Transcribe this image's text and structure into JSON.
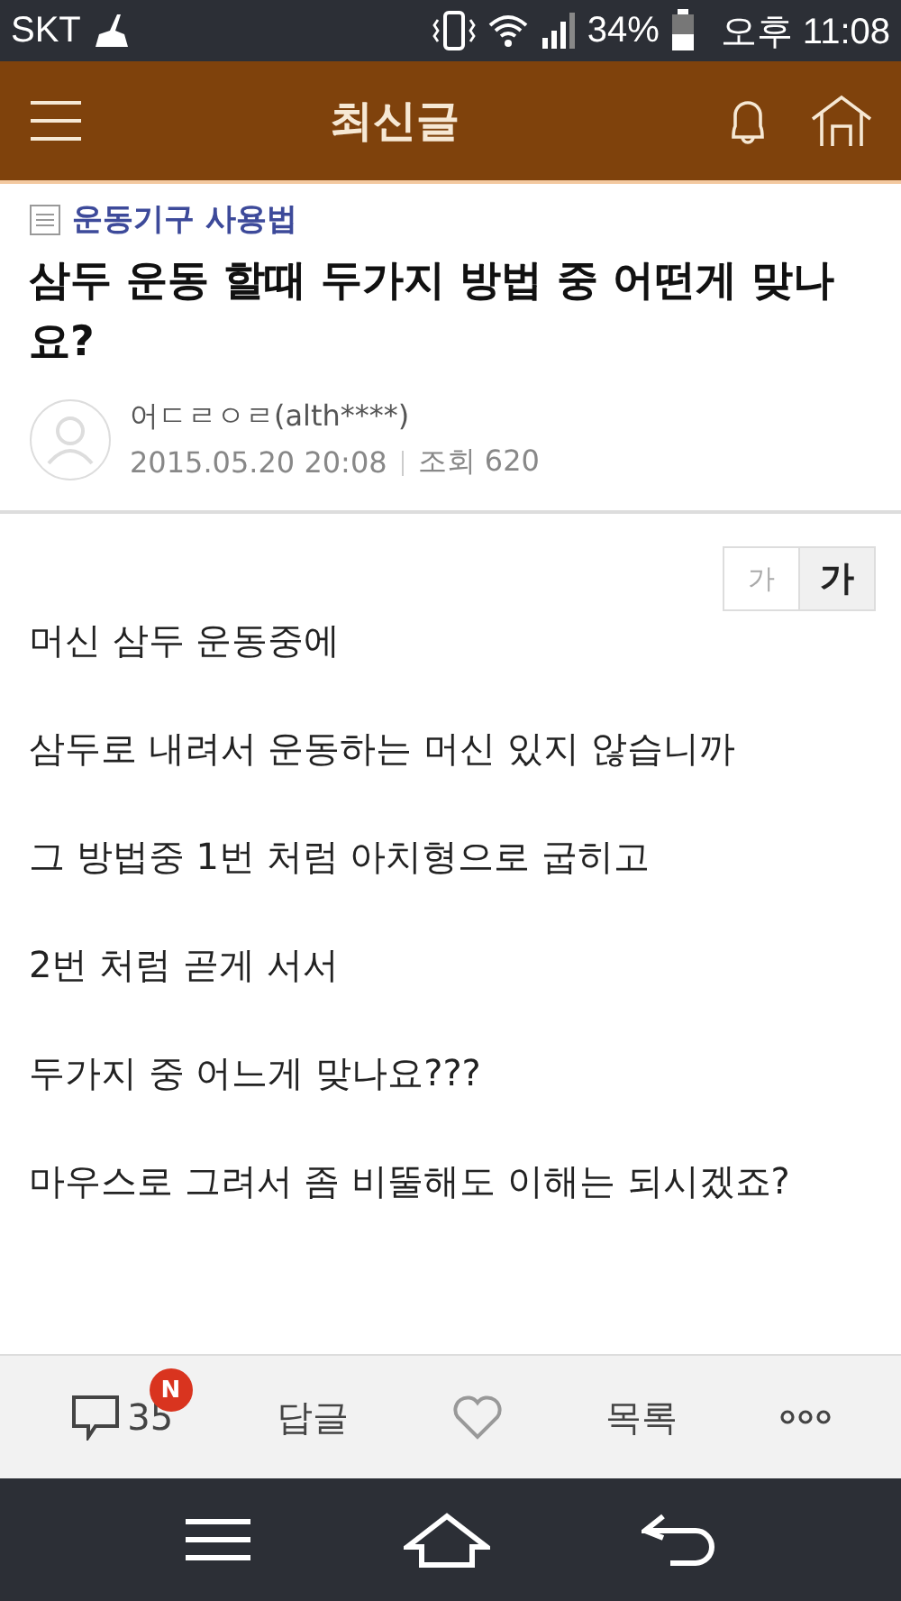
{
  "status_bar": {
    "carrier": "SKT",
    "battery_percent": "34%",
    "time": "오후 11:08"
  },
  "header": {
    "title": "최신글"
  },
  "post": {
    "category": "운동기구 사용법",
    "title": "삼두 운동 할때 두가지 방법 중 어떤게 맞나요?",
    "author": "어ㄷㄹㅇㄹ(alth****)",
    "date": "2015.05.20 20:08",
    "views": "조회 620"
  },
  "font_size_buttons": [
    {
      "label": "가",
      "selected": false
    },
    {
      "label": "가",
      "selected": true
    }
  ],
  "body_paragraphs": [
    "머신 삼두 운동중에",
    "삼두로 내려서 운동하는 머신 있지 않습니까",
    "그 방법중 1번 처럼 아치형으로 굽히고",
    "2번 처럼 곧게 서서",
    "두가지 중 어느게 맞나요???",
    "마우스로 그려서 좀 비뚤해도 이해는 되시겠죠?"
  ],
  "action_bar": {
    "comment_count": "35",
    "new_badge": "N",
    "reply": "답글",
    "list": "목록"
  }
}
